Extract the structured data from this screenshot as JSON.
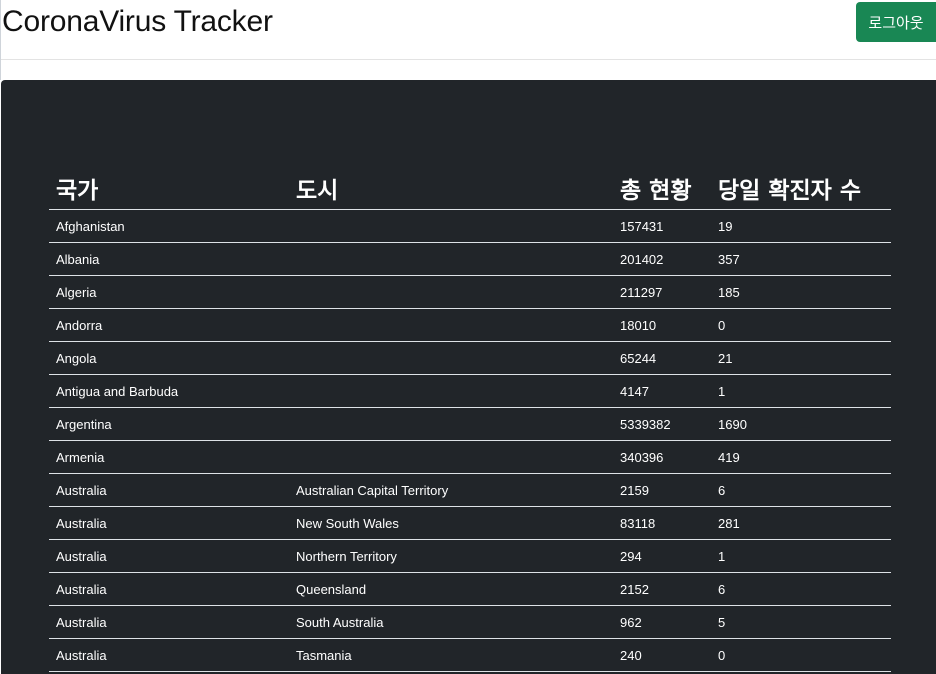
{
  "header": {
    "title": "CoronaVirus Tracker",
    "logout_label": "로그아웃"
  },
  "table": {
    "headers": {
      "country": "국가",
      "city": "도시",
      "total": "총 현황",
      "daily": "당일 확진자 수"
    },
    "rows": [
      {
        "country": "Afghanistan",
        "city": "",
        "total": "157431",
        "daily": "19"
      },
      {
        "country": "Albania",
        "city": "",
        "total": "201402",
        "daily": "357"
      },
      {
        "country": "Algeria",
        "city": "",
        "total": "211297",
        "daily": "185"
      },
      {
        "country": "Andorra",
        "city": "",
        "total": "18010",
        "daily": "0"
      },
      {
        "country": "Angola",
        "city": "",
        "total": "65244",
        "daily": "21"
      },
      {
        "country": "Antigua and Barbuda",
        "city": "",
        "total": "4147",
        "daily": "1"
      },
      {
        "country": "Argentina",
        "city": "",
        "total": "5339382",
        "daily": "1690"
      },
      {
        "country": "Armenia",
        "city": "",
        "total": "340396",
        "daily": "419"
      },
      {
        "country": "Australia",
        "city": "Australian Capital Territory",
        "total": "2159",
        "daily": "6"
      },
      {
        "country": "Australia",
        "city": "New South Wales",
        "total": "83118",
        "daily": "281"
      },
      {
        "country": "Australia",
        "city": "Northern Territory",
        "total": "294",
        "daily": "1"
      },
      {
        "country": "Australia",
        "city": "Queensland",
        "total": "2152",
        "daily": "6"
      },
      {
        "country": "Australia",
        "city": "South Australia",
        "total": "962",
        "daily": "5"
      },
      {
        "country": "Australia",
        "city": "Tasmania",
        "total": "240",
        "daily": "0"
      }
    ]
  }
}
